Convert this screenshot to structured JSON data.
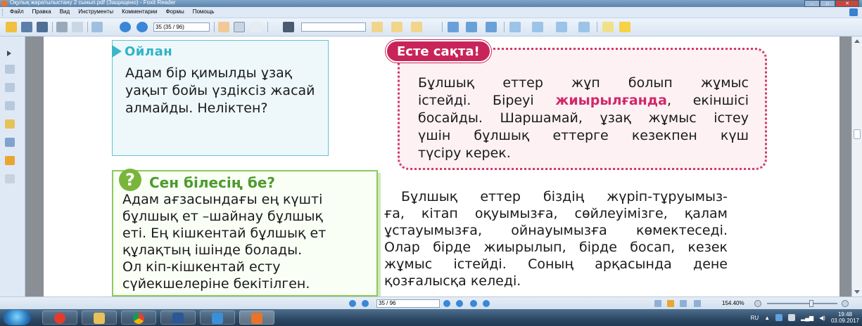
{
  "window": {
    "title": "Оқулық жаратылыстану 2 сынып.pdf (Защищено) - Foxit Reader"
  },
  "menu": {
    "items": [
      "Файл",
      "Правка",
      "Вид",
      "Инструменты",
      "Комментарии",
      "Формы",
      "Помощь"
    ]
  },
  "toolbar": {
    "page_field_value": "35 (35 / 96)"
  },
  "document": {
    "ojlan": {
      "title": "Ойлан",
      "lines": [
        "Адам бір қимылды ұзақ",
        "уақыт бойы үздіксіз жасай",
        "алмайды. Неліктен?"
      ]
    },
    "este_sakta": {
      "title": "Есте сақта!",
      "line1": "Бұлшық еттер жұп болып жұмыс",
      "line2_prefix": "істейді. Біреуі ",
      "line2_highlight": "жиырылғанда",
      "line2_suffix": ", екіншісі",
      "line3": "босайды. Шаршамай, ұзақ жұмыс істеу",
      "line4": "үшін бұлшық еттерге кезекпен күш",
      "line5": "түсіру керек."
    },
    "sen_bilesin": {
      "icon_glyph": "?",
      "title": "Сен білесің бе?",
      "lines": [
        "Адам ағзасындағы ең күшті",
        "бұлшық ет –шайнау бұлшық",
        "еті. Ең кішкентай бұлшық ет",
        "құлақтың ішінде болады.",
        "Ол кіп-кішкентай есту",
        "сүйекшелеріне бекітілген."
      ]
    },
    "main_paragraph": {
      "lines": [
        "Бұлшық еттер біздің жүріп-тұруымыз-",
        "ға, кітап оқуымызға, сөйлеуімізге, қалам",
        "ұстауымызға, ойнауымызға көмектеседі.",
        "Олар бірде жиырылып, бірде босап, кезек",
        "жұмыс істейді. Соның арқасында дене",
        "қозғалысқа келеді."
      ]
    },
    "colors": {
      "teal": "#2fb3c6",
      "pink": "#c8245a",
      "green": "#4d9a2e"
    }
  },
  "statusbar": {
    "page_value": "35 / 96",
    "zoom": "154.40%"
  },
  "taskbar": {
    "language": "RU",
    "time": "19:48",
    "date": "03.09.2017"
  }
}
